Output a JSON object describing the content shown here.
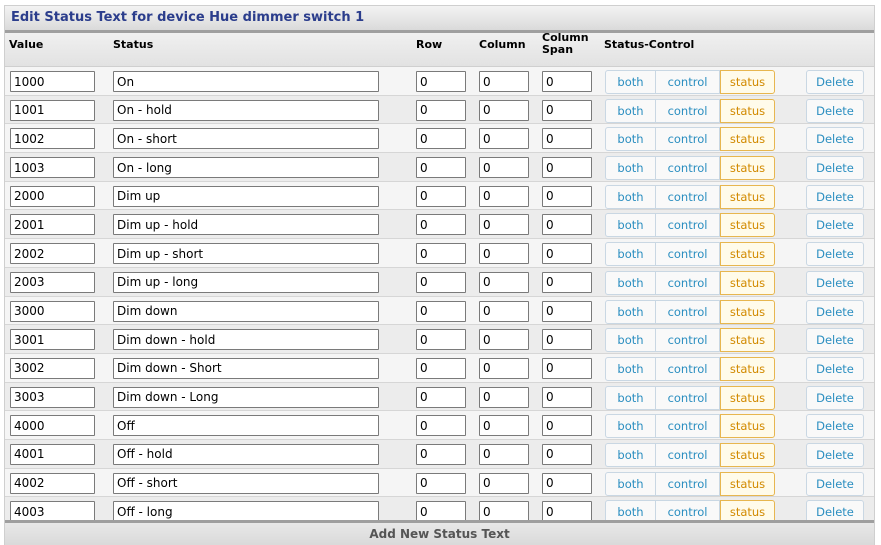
{
  "title": "Edit Status Text for device Hue dimmer switch 1",
  "headers": {
    "value": "Value",
    "status": "Status",
    "row": "Row",
    "column": "Column",
    "column_span": "Column Span",
    "status_control": "Status-Control"
  },
  "buttons": {
    "both": "both",
    "control": "control",
    "status": "status",
    "delete": "Delete"
  },
  "rows": [
    {
      "value": "1000",
      "status": "On",
      "row": "0",
      "column": "0",
      "span": "0"
    },
    {
      "value": "1001",
      "status": "On - hold",
      "row": "0",
      "column": "0",
      "span": "0"
    },
    {
      "value": "1002",
      "status": "On - short",
      "row": "0",
      "column": "0",
      "span": "0"
    },
    {
      "value": "1003",
      "status": "On - long",
      "row": "0",
      "column": "0",
      "span": "0"
    },
    {
      "value": "2000",
      "status": "Dim up",
      "row": "0",
      "column": "0",
      "span": "0"
    },
    {
      "value": "2001",
      "status": "Dim up - hold",
      "row": "0",
      "column": "0",
      "span": "0"
    },
    {
      "value": "2002",
      "status": "Dim up - short",
      "row": "0",
      "column": "0",
      "span": "0"
    },
    {
      "value": "2003",
      "status": "Dim up - long",
      "row": "0",
      "column": "0",
      "span": "0"
    },
    {
      "value": "3000",
      "status": "Dim down",
      "row": "0",
      "column": "0",
      "span": "0"
    },
    {
      "value": "3001",
      "status": "Dim down - hold",
      "row": "0",
      "column": "0",
      "span": "0"
    },
    {
      "value": "3002",
      "status": "Dim down - Short",
      "row": "0",
      "column": "0",
      "span": "0"
    },
    {
      "value": "3003",
      "status": "Dim down - Long",
      "row": "0",
      "column": "0",
      "span": "0"
    },
    {
      "value": "4000",
      "status": "Off",
      "row": "0",
      "column": "0",
      "span": "0"
    },
    {
      "value": "4001",
      "status": "Off - hold",
      "row": "0",
      "column": "0",
      "span": "0"
    },
    {
      "value": "4002",
      "status": "Off - short",
      "row": "0",
      "column": "0",
      "span": "0"
    },
    {
      "value": "4003",
      "status": "Off - long",
      "row": "0",
      "column": "0",
      "span": "0"
    }
  ],
  "footer": "Add New Status Text",
  "colors": {
    "title": "#2b3d8c",
    "link": "#2a8ec0",
    "selected_status": "#d28a00"
  }
}
